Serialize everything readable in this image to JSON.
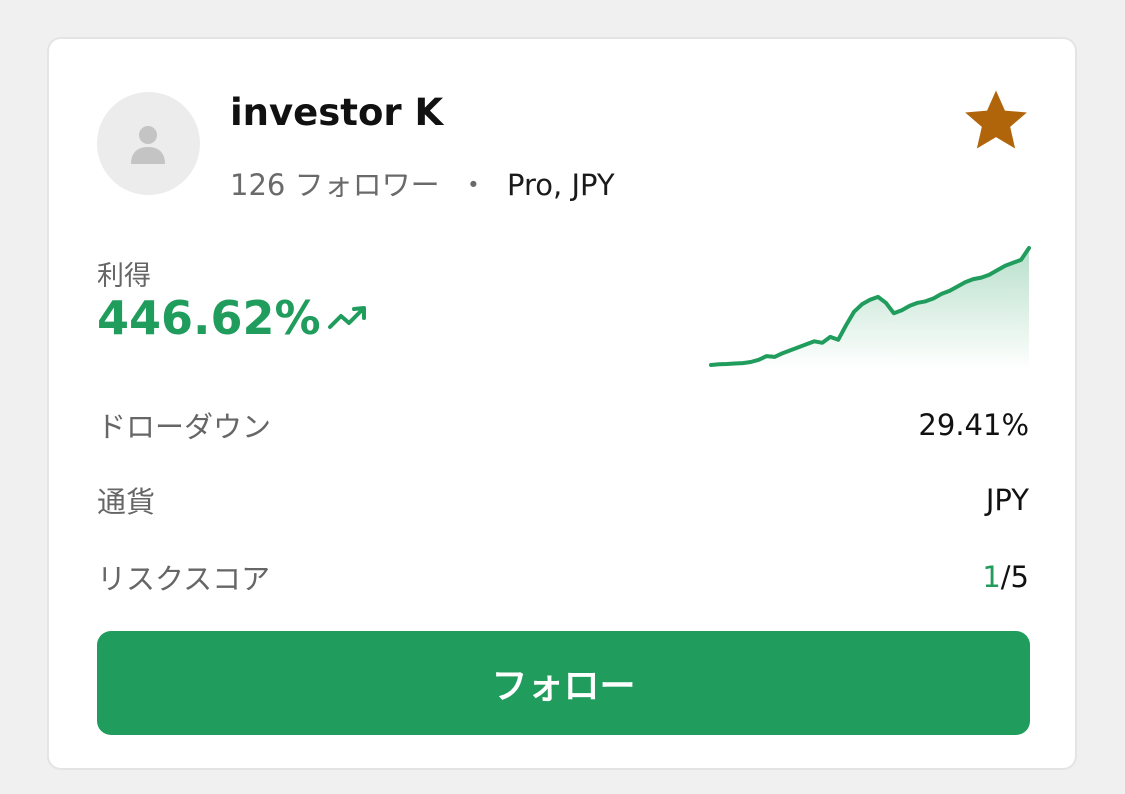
{
  "trader": {
    "name": "investor K",
    "followers_count": "126",
    "followers_label": "フォロワー",
    "separator": "・",
    "plan_currency": "Pro, JPY"
  },
  "profit": {
    "label": "利得",
    "value": "446.62%",
    "trend_icon": "trending-up-icon"
  },
  "sparkline": {
    "values": [
      0,
      0.5,
      0.7,
      1,
      1.3,
      2,
      3.5,
      6,
      5.5,
      8,
      10,
      12,
      14,
      16,
      15,
      19,
      17,
      27,
      36,
      41,
      44,
      46,
      42,
      35,
      37,
      40,
      42,
      43,
      45,
      48,
      50,
      53,
      56,
      58,
      59,
      61,
      64,
      67,
      69,
      71,
      79
    ],
    "line_color": "#209c5d"
  },
  "stats": [
    {
      "label": "ドローダウン",
      "value": "29.41%"
    },
    {
      "label": "通貨",
      "value": "JPY"
    }
  ],
  "risk": {
    "label": "リスクスコア",
    "score": "1",
    "max": "/5"
  },
  "follow_button": {
    "label": "フォロー"
  },
  "colors": {
    "accent": "#209c5d",
    "star": "#b0650a",
    "background": "#f0f0f0"
  }
}
